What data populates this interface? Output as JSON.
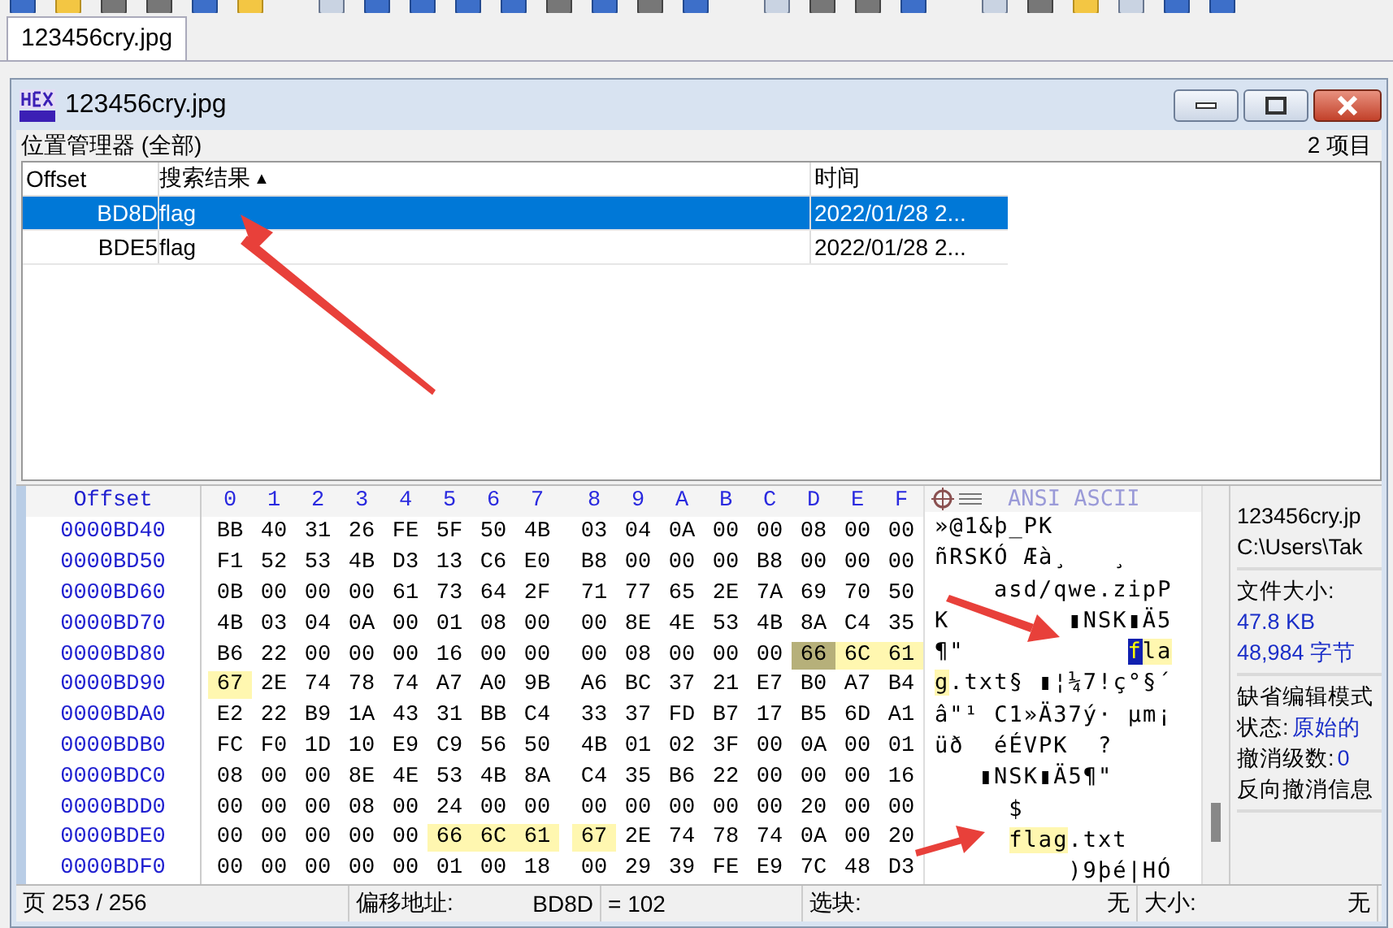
{
  "app_tab": {
    "label": "123456cry.jpg",
    "selected": true
  },
  "window": {
    "title": "123456cry.jpg"
  },
  "location_manager": {
    "title": "位置管理器 (全部)",
    "count": "2 项目",
    "columns": [
      "Offset",
      "搜索结果",
      "时间"
    ],
    "sort_indicator": "▲",
    "rows": [
      {
        "offset": "BD8D",
        "result": "flag",
        "time": "2022/01/28  2...",
        "selected": true
      },
      {
        "offset": "BDE5",
        "result": "flag",
        "time": "2022/01/28  2...",
        "selected": false
      }
    ]
  },
  "hex_view": {
    "offset_header": "Offset",
    "column_headers": [
      "0",
      "1",
      "2",
      "3",
      "4",
      "5",
      "6",
      "7",
      "8",
      "9",
      "A",
      "B",
      "C",
      "D",
      "E",
      "F"
    ],
    "text_header": "ANSI ASCII",
    "rows": [
      {
        "offset": "0000BD40",
        "ascii": [
          "»@1&þ_PK"
        ],
        "bytes": [
          {
            "text": "BB",
            "highlighted": false,
            "selected": false
          },
          {
            "text": "40",
            "highlighted": false,
            "selected": false
          },
          {
            "text": "31",
            "highlighted": false,
            "selected": false
          },
          {
            "text": "26",
            "highlighted": false,
            "selected": false
          },
          {
            "text": "FE",
            "highlighted": false,
            "selected": false
          },
          {
            "text": "5F",
            "highlighted": false,
            "selected": false
          },
          {
            "text": "50",
            "highlighted": false,
            "selected": false
          },
          {
            "text": "4B",
            "highlighted": false,
            "selected": false
          },
          {
            "text": "03",
            "highlighted": false,
            "selected": false
          },
          {
            "text": "04",
            "highlighted": false,
            "selected": false
          },
          {
            "text": "0A",
            "highlighted": false,
            "selected": false
          },
          {
            "text": "00",
            "highlighted": false,
            "selected": false
          },
          {
            "text": "00",
            "highlighted": false,
            "selected": false
          },
          {
            "text": "08",
            "highlighted": false,
            "selected": false
          },
          {
            "text": "00",
            "highlighted": false,
            "selected": false
          },
          {
            "text": "00",
            "highlighted": false,
            "selected": false
          }
        ]
      },
      {
        "offset": "0000BD50",
        "ascii": [
          "ñRSKÓ Æà¸",
          "   ¸"
        ],
        "bytes": [
          {
            "text": "F1",
            "highlighted": false,
            "selected": false
          },
          {
            "text": "52",
            "highlighted": false,
            "selected": false
          },
          {
            "text": "53",
            "highlighted": false,
            "selected": false
          },
          {
            "text": "4B",
            "highlighted": false,
            "selected": false
          },
          {
            "text": "D3",
            "highlighted": false,
            "selected": false
          },
          {
            "text": "13",
            "highlighted": false,
            "selected": false
          },
          {
            "text": "C6",
            "highlighted": false,
            "selected": false
          },
          {
            "text": "E0",
            "highlighted": false,
            "selected": false
          },
          {
            "text": "B8",
            "highlighted": false,
            "selected": false
          },
          {
            "text": "00",
            "highlighted": false,
            "selected": false
          },
          {
            "text": "00",
            "highlighted": false,
            "selected": false
          },
          {
            "text": "00",
            "highlighted": false,
            "selected": false
          },
          {
            "text": "B8",
            "highlighted": false,
            "selected": false
          },
          {
            "text": "00",
            "highlighted": false,
            "selected": false
          },
          {
            "text": "00",
            "highlighted": false,
            "selected": false
          },
          {
            "text": "00",
            "highlighted": false,
            "selected": false
          }
        ]
      },
      {
        "offset": "0000BD60",
        "ascii": [
          "    asd/qwe.zipP"
        ],
        "bytes": [
          {
            "text": "0B",
            "highlighted": false,
            "selected": false
          },
          {
            "text": "00",
            "highlighted": false,
            "selected": false
          },
          {
            "text": "00",
            "highlighted": false,
            "selected": false
          },
          {
            "text": "00",
            "highlighted": false,
            "selected": false
          },
          {
            "text": "61",
            "highlighted": false,
            "selected": false
          },
          {
            "text": "73",
            "highlighted": false,
            "selected": false
          },
          {
            "text": "64",
            "highlighted": false,
            "selected": false
          },
          {
            "text": "2F",
            "highlighted": false,
            "selected": false
          },
          {
            "text": "71",
            "highlighted": false,
            "selected": false
          },
          {
            "text": "77",
            "highlighted": false,
            "selected": false
          },
          {
            "text": "65",
            "highlighted": false,
            "selected": false
          },
          {
            "text": "2E",
            "highlighted": false,
            "selected": false
          },
          {
            "text": "7A",
            "highlighted": false,
            "selected": false
          },
          {
            "text": "69",
            "highlighted": false,
            "selected": false
          },
          {
            "text": "70",
            "highlighted": false,
            "selected": false
          },
          {
            "text": "50",
            "highlighted": false,
            "selected": false
          }
        ]
      },
      {
        "offset": "0000BD70",
        "ascii": [
          "K",
          "        ▮NSK▮Ä5"
        ],
        "bytes": [
          {
            "text": "4B",
            "highlighted": false,
            "selected": false
          },
          {
            "text": "03",
            "highlighted": false,
            "selected": false
          },
          {
            "text": "04",
            "highlighted": false,
            "selected": false
          },
          {
            "text": "0A",
            "highlighted": false,
            "selected": false
          },
          {
            "text": "00",
            "highlighted": false,
            "selected": false
          },
          {
            "text": "01",
            "highlighted": false,
            "selected": false
          },
          {
            "text": "08",
            "highlighted": false,
            "selected": false
          },
          {
            "text": "00",
            "highlighted": false,
            "selected": false
          },
          {
            "text": "00",
            "highlighted": false,
            "selected": false
          },
          {
            "text": "8E",
            "highlighted": false,
            "selected": false
          },
          {
            "text": "4E",
            "highlighted": false,
            "selected": false
          },
          {
            "text": "53",
            "highlighted": false,
            "selected": false
          },
          {
            "text": "4B",
            "highlighted": false,
            "selected": false
          },
          {
            "text": "8A",
            "highlighted": false,
            "selected": false
          },
          {
            "text": "C4",
            "highlighted": false,
            "selected": false
          },
          {
            "text": "35",
            "highlighted": false,
            "selected": false
          }
        ]
      },
      {
        "offset": "0000BD80",
        "ascii": [
          "¶\"",
          "           fla"
        ],
        "bytes": [
          {
            "text": "B6",
            "highlighted": false,
            "selected": false
          },
          {
            "text": "22",
            "highlighted": false,
            "selected": false
          },
          {
            "text": "00",
            "highlighted": false,
            "selected": false
          },
          {
            "text": "00",
            "highlighted": false,
            "selected": false
          },
          {
            "text": "00",
            "highlighted": false,
            "selected": false
          },
          {
            "text": "16",
            "highlighted": false,
            "selected": false
          },
          {
            "text": "00",
            "highlighted": false,
            "selected": false
          },
          {
            "text": "00",
            "highlighted": false,
            "selected": false
          },
          {
            "text": "00",
            "highlighted": false,
            "selected": false
          },
          {
            "text": "08",
            "highlighted": false,
            "selected": false
          },
          {
            "text": "00",
            "highlighted": false,
            "selected": false
          },
          {
            "text": "00",
            "highlighted": false,
            "selected": false
          },
          {
            "text": "00",
            "highlighted": false,
            "selected": false
          },
          {
            "text": "66",
            "highlighted": true,
            "selected": true
          },
          {
            "text": "6C",
            "highlighted": true,
            "selected": false
          },
          {
            "text": "61",
            "highlighted": true,
            "selected": false
          }
        ]
      },
      {
        "offset": "0000BD90",
        "ascii": [
          "g.txt§ ▮¦¼7!ç°§´"
        ],
        "bytes": [
          {
            "text": "67",
            "highlighted": true,
            "selected": false
          },
          {
            "text": "2E",
            "highlighted": false,
            "selected": false
          },
          {
            "text": "74",
            "highlighted": false,
            "selected": false
          },
          {
            "text": "78",
            "highlighted": false,
            "selected": false
          },
          {
            "text": "74",
            "highlighted": false,
            "selected": false
          },
          {
            "text": "A7",
            "highlighted": false,
            "selected": false
          },
          {
            "text": "A0",
            "highlighted": false,
            "selected": false
          },
          {
            "text": "9B",
            "highlighted": false,
            "selected": false
          },
          {
            "text": "A6",
            "highlighted": false,
            "selected": false
          },
          {
            "text": "BC",
            "highlighted": false,
            "selected": false
          },
          {
            "text": "37",
            "highlighted": false,
            "selected": false
          },
          {
            "text": "21",
            "highlighted": false,
            "selected": false
          },
          {
            "text": "E7",
            "highlighted": false,
            "selected": false
          },
          {
            "text": "B0",
            "highlighted": false,
            "selected": false
          },
          {
            "text": "A7",
            "highlighted": false,
            "selected": false
          },
          {
            "text": "B4",
            "highlighted": false,
            "selected": false
          }
        ]
      },
      {
        "offset": "0000BDA0",
        "ascii": [
          "â\"¹ C1»Ä37ý· µm¡"
        ],
        "bytes": [
          {
            "text": "E2",
            "highlighted": false,
            "selected": false
          },
          {
            "text": "22",
            "highlighted": false,
            "selected": false
          },
          {
            "text": "B9",
            "highlighted": false,
            "selected": false
          },
          {
            "text": "1A",
            "highlighted": false,
            "selected": false
          },
          {
            "text": "43",
            "highlighted": false,
            "selected": false
          },
          {
            "text": "31",
            "highlighted": false,
            "selected": false
          },
          {
            "text": "BB",
            "highlighted": false,
            "selected": false
          },
          {
            "text": "C4",
            "highlighted": false,
            "selected": false
          },
          {
            "text": "33",
            "highlighted": false,
            "selected": false
          },
          {
            "text": "37",
            "highlighted": false,
            "selected": false
          },
          {
            "text": "FD",
            "highlighted": false,
            "selected": false
          },
          {
            "text": "B7",
            "highlighted": false,
            "selected": false
          },
          {
            "text": "17",
            "highlighted": false,
            "selected": false
          },
          {
            "text": "B5",
            "highlighted": false,
            "selected": false
          },
          {
            "text": "6D",
            "highlighted": false,
            "selected": false
          },
          {
            "text": "A1",
            "highlighted": false,
            "selected": false
          }
        ]
      },
      {
        "offset": "0000BDB0",
        "ascii": [
          "üð",
          "  éÉVPK",
          "  ?"
        ],
        "bytes": [
          {
            "text": "FC",
            "highlighted": false,
            "selected": false
          },
          {
            "text": "F0",
            "highlighted": false,
            "selected": false
          },
          {
            "text": "1D",
            "highlighted": false,
            "selected": false
          },
          {
            "text": "10",
            "highlighted": false,
            "selected": false
          },
          {
            "text": "E9",
            "highlighted": false,
            "selected": false
          },
          {
            "text": "C9",
            "highlighted": false,
            "selected": false
          },
          {
            "text": "56",
            "highlighted": false,
            "selected": false
          },
          {
            "text": "50",
            "highlighted": false,
            "selected": false
          },
          {
            "text": "4B",
            "highlighted": false,
            "selected": false
          },
          {
            "text": "01",
            "highlighted": false,
            "selected": false
          },
          {
            "text": "02",
            "highlighted": false,
            "selected": false
          },
          {
            "text": "3F",
            "highlighted": false,
            "selected": false
          },
          {
            "text": "00",
            "highlighted": false,
            "selected": false
          },
          {
            "text": "0A",
            "highlighted": false,
            "selected": false
          },
          {
            "text": "00",
            "highlighted": false,
            "selected": false
          },
          {
            "text": "01",
            "highlighted": false,
            "selected": false
          }
        ]
      },
      {
        "offset": "0000BDC0",
        "ascii": [
          "   ▮NSK▮Ä5¶\""
        ],
        "bytes": [
          {
            "text": "08",
            "highlighted": false,
            "selected": false
          },
          {
            "text": "00",
            "highlighted": false,
            "selected": false
          },
          {
            "text": "00",
            "highlighted": false,
            "selected": false
          },
          {
            "text": "8E",
            "highlighted": false,
            "selected": false
          },
          {
            "text": "4E",
            "highlighted": false,
            "selected": false
          },
          {
            "text": "53",
            "highlighted": false,
            "selected": false
          },
          {
            "text": "4B",
            "highlighted": false,
            "selected": false
          },
          {
            "text": "8A",
            "highlighted": false,
            "selected": false
          },
          {
            "text": "C4",
            "highlighted": false,
            "selected": false
          },
          {
            "text": "35",
            "highlighted": false,
            "selected": false
          },
          {
            "text": "B6",
            "highlighted": false,
            "selected": false
          },
          {
            "text": "22",
            "highlighted": false,
            "selected": false
          },
          {
            "text": "00",
            "highlighted": false,
            "selected": false
          },
          {
            "text": "00",
            "highlighted": false,
            "selected": false
          },
          {
            "text": "00",
            "highlighted": false,
            "selected": false
          },
          {
            "text": "16",
            "highlighted": false,
            "selected": false
          }
        ]
      },
      {
        "offset": "0000BDD0",
        "ascii": [
          "     $"
        ],
        "bytes": [
          {
            "text": "00",
            "highlighted": false,
            "selected": false
          },
          {
            "text": "00",
            "highlighted": false,
            "selected": false
          },
          {
            "text": "00",
            "highlighted": false,
            "selected": false
          },
          {
            "text": "08",
            "highlighted": false,
            "selected": false
          },
          {
            "text": "00",
            "highlighted": false,
            "selected": false
          },
          {
            "text": "24",
            "highlighted": false,
            "selected": false
          },
          {
            "text": "00",
            "highlighted": false,
            "selected": false
          },
          {
            "text": "00",
            "highlighted": false,
            "selected": false
          },
          {
            "text": "00",
            "highlighted": false,
            "selected": false
          },
          {
            "text": "00",
            "highlighted": false,
            "selected": false
          },
          {
            "text": "00",
            "highlighted": false,
            "selected": false
          },
          {
            "text": "00",
            "highlighted": false,
            "selected": false
          },
          {
            "text": "00",
            "highlighted": false,
            "selected": false
          },
          {
            "text": "20",
            "highlighted": false,
            "selected": false
          },
          {
            "text": "00",
            "highlighted": false,
            "selected": false
          },
          {
            "text": "00",
            "highlighted": false,
            "selected": false
          }
        ]
      },
      {
        "offset": "0000BDE0",
        "ascii": [
          "     flag.txt"
        ],
        "bytes": [
          {
            "text": "00",
            "highlighted": false,
            "selected": false
          },
          {
            "text": "00",
            "highlighted": false,
            "selected": false
          },
          {
            "text": "00",
            "highlighted": false,
            "selected": false
          },
          {
            "text": "00",
            "highlighted": false,
            "selected": false
          },
          {
            "text": "00",
            "highlighted": false,
            "selected": false
          },
          {
            "text": "66",
            "highlighted": true,
            "selected": false
          },
          {
            "text": "6C",
            "highlighted": true,
            "selected": false
          },
          {
            "text": "61",
            "highlighted": true,
            "selected": false
          },
          {
            "text": "67",
            "highlighted": true,
            "selected": false
          },
          {
            "text": "2E",
            "highlighted": false,
            "selected": false
          },
          {
            "text": "74",
            "highlighted": false,
            "selected": false
          },
          {
            "text": "78",
            "highlighted": false,
            "selected": false
          },
          {
            "text": "74",
            "highlighted": false,
            "selected": false
          },
          {
            "text": "0A",
            "highlighted": false,
            "selected": false
          },
          {
            "text": "00",
            "highlighted": false,
            "selected": false
          },
          {
            "text": "20",
            "highlighted": false,
            "selected": false
          }
        ]
      },
      {
        "offset": "0000BDF0",
        "ascii": [
          "         )9þé|HÓ"
        ],
        "bytes": [
          {
            "text": "00",
            "highlighted": false,
            "selected": false
          },
          {
            "text": "00",
            "highlighted": false,
            "selected": false
          },
          {
            "text": "00",
            "highlighted": false,
            "selected": false
          },
          {
            "text": "00",
            "highlighted": false,
            "selected": false
          },
          {
            "text": "00",
            "highlighted": false,
            "selected": false
          },
          {
            "text": "01",
            "highlighted": false,
            "selected": false
          },
          {
            "text": "00",
            "highlighted": false,
            "selected": false
          },
          {
            "text": "18",
            "highlighted": false,
            "selected": false
          },
          {
            "text": "00",
            "highlighted": false,
            "selected": false
          },
          {
            "text": "29",
            "highlighted": false,
            "selected": false
          },
          {
            "text": "39",
            "highlighted": false,
            "selected": false
          },
          {
            "text": "FE",
            "highlighted": false,
            "selected": false
          },
          {
            "text": "E9",
            "highlighted": false,
            "selected": false
          },
          {
            "text": "7C",
            "highlighted": false,
            "selected": false
          },
          {
            "text": "48",
            "highlighted": false,
            "selected": false
          },
          {
            "text": "D3",
            "highlighted": false,
            "selected": false
          }
        ]
      }
    ]
  },
  "info_panel": {
    "sections": [
      {
        "lines": [
          {
            "label": "123456cry.jp"
          },
          {
            "label": "C:\\Users\\Tak"
          }
        ]
      },
      {
        "lines": [
          {
            "label": "文件大小:"
          },
          {
            "value": "47.8 KB"
          },
          {
            "value": "48,984 字节"
          }
        ]
      },
      {
        "lines": [
          {
            "label": "缺省编辑模式"
          },
          {
            "label": "状态:",
            "value": "原始的"
          },
          {
            "label": "撤消级数:",
            "value": "0"
          },
          {
            "label": "反向撤消信息"
          }
        ]
      }
    ]
  },
  "status_bar": {
    "page": "页 253 / 256",
    "offset_label": "偏移地址:",
    "offset_value": "BD8D",
    "value": "= 102",
    "block_label": "选块:",
    "block_value": "无",
    "size_label": "大小:",
    "size_value": "无"
  }
}
